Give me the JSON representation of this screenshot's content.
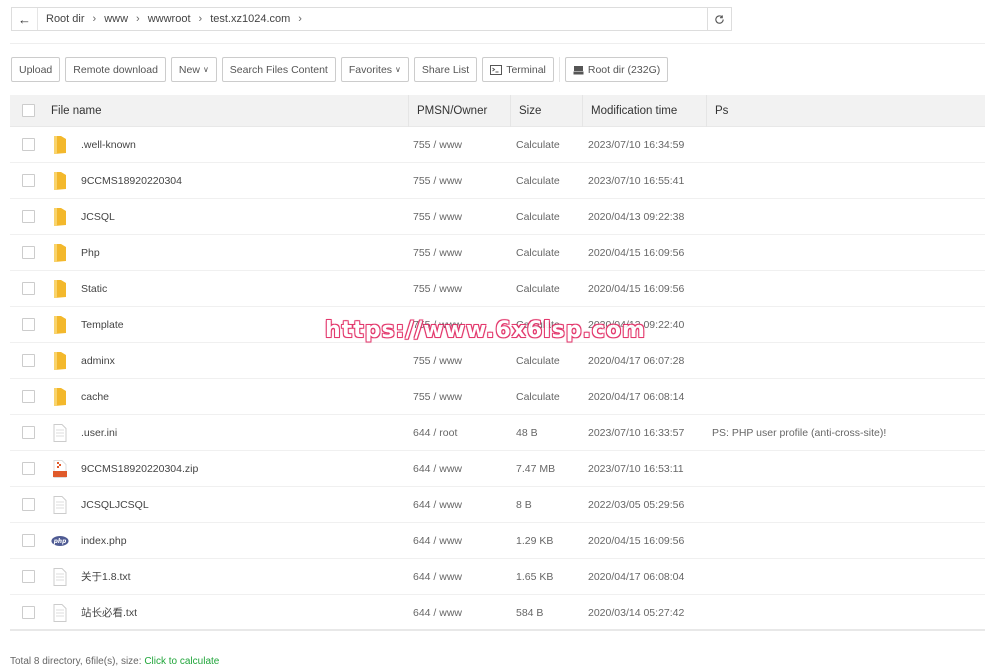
{
  "pathbar": {
    "crumbs": [
      "Root dir",
      "www",
      "wwwroot",
      "test.xz1024.com"
    ]
  },
  "toolbar": {
    "upload": "Upload",
    "remote_download": "Remote download",
    "new": "New",
    "search_files": "Search Files Content",
    "favorites": "Favorites",
    "share_list": "Share List",
    "terminal": "Terminal",
    "root_dir": "Root dir (232G)"
  },
  "table": {
    "headers": {
      "name": "File name",
      "perm": "PMSN/Owner",
      "size": "Size",
      "time": "Modification time",
      "ps": "Ps"
    },
    "rows": [
      {
        "icon": "folder-icon",
        "name": ".well-known",
        "perm": "755 / www",
        "size": "Calculate",
        "time": "2023/07/10 16:34:59",
        "ps": ""
      },
      {
        "icon": "folder-icon",
        "name": "9CCMS18920220304",
        "perm": "755 / www",
        "size": "Calculate",
        "time": "2023/07/10 16:55:41",
        "ps": ""
      },
      {
        "icon": "folder-icon",
        "name": "JCSQL",
        "perm": "755 / www",
        "size": "Calculate",
        "time": "2020/04/13 09:22:38",
        "ps": ""
      },
      {
        "icon": "folder-icon",
        "name": "Php",
        "perm": "755 / www",
        "size": "Calculate",
        "time": "2020/04/15 16:09:56",
        "ps": ""
      },
      {
        "icon": "folder-icon",
        "name": "Static",
        "perm": "755 / www",
        "size": "Calculate",
        "time": "2020/04/15 16:09:56",
        "ps": ""
      },
      {
        "icon": "folder-icon",
        "name": "Template",
        "perm": "755 / www",
        "size": "Calculate",
        "time": "2020/04/13 09:22:40",
        "ps": ""
      },
      {
        "icon": "folder-icon",
        "name": "adminx",
        "perm": "755 / www",
        "size": "Calculate",
        "time": "2020/04/17 06:07:28",
        "ps": ""
      },
      {
        "icon": "folder-icon",
        "name": "cache",
        "perm": "755 / www",
        "size": "Calculate",
        "time": "2020/04/17 06:08:14",
        "ps": ""
      },
      {
        "icon": "file-icon",
        "name": ".user.ini",
        "perm": "644 / root",
        "size": "48 B",
        "time": "2023/07/10 16:33:57",
        "ps": "PS: PHP user profile (anti-cross-site)!"
      },
      {
        "icon": "zip-icon",
        "name": "9CCMS18920220304.zip",
        "perm": "644 / www",
        "size": "7.47 MB",
        "time": "2023/07/10 16:53:11",
        "ps": ""
      },
      {
        "icon": "file-icon",
        "name": "JCSQLJCSQL",
        "perm": "644 / www",
        "size": "8 B",
        "time": "2022/03/05 05:29:56",
        "ps": ""
      },
      {
        "icon": "php-icon",
        "name": "index.php",
        "perm": "644 / www",
        "size": "1.29 KB",
        "time": "2020/04/15 16:09:56",
        "ps": ""
      },
      {
        "icon": "file-icon",
        "name": "关于1.8.txt",
        "perm": "644 / www",
        "size": "1.65 KB",
        "time": "2020/04/17 06:08:04",
        "ps": ""
      },
      {
        "icon": "file-icon",
        "name": "站长必看.txt",
        "perm": "644 / www",
        "size": "584 B",
        "time": "2020/03/14 05:27:42",
        "ps": ""
      }
    ]
  },
  "footer": {
    "summary": "Total 8 directory, 6file(s), size:",
    "link": "Click to calculate"
  },
  "watermark": "https://www.6x6lsp.com",
  "colors": {
    "accent_green": "#20a53a",
    "folder_yellow": "#f7c948",
    "watermark_red": "#e0245e"
  }
}
